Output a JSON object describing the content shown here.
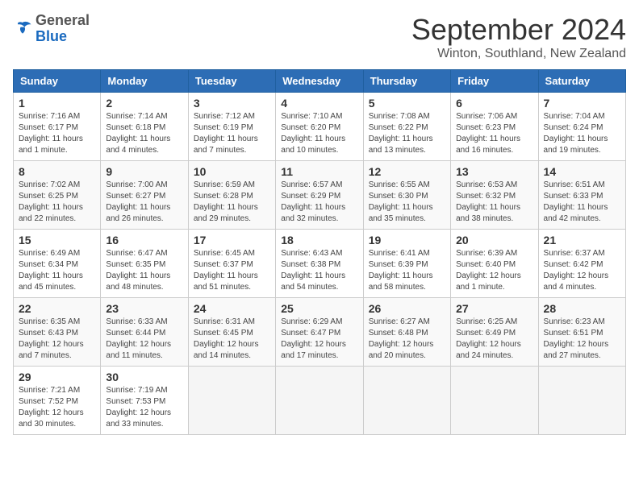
{
  "logo": {
    "general": "General",
    "blue": "Blue"
  },
  "header": {
    "month": "September 2024",
    "location": "Winton, Southland, New Zealand"
  },
  "days_of_week": [
    "Sunday",
    "Monday",
    "Tuesday",
    "Wednesday",
    "Thursday",
    "Friday",
    "Saturday"
  ],
  "weeks": [
    [
      {
        "day": "1",
        "info": "Sunrise: 7:16 AM\nSunset: 6:17 PM\nDaylight: 11 hours and 1 minute."
      },
      {
        "day": "2",
        "info": "Sunrise: 7:14 AM\nSunset: 6:18 PM\nDaylight: 11 hours and 4 minutes."
      },
      {
        "day": "3",
        "info": "Sunrise: 7:12 AM\nSunset: 6:19 PM\nDaylight: 11 hours and 7 minutes."
      },
      {
        "day": "4",
        "info": "Sunrise: 7:10 AM\nSunset: 6:20 PM\nDaylight: 11 hours and 10 minutes."
      },
      {
        "day": "5",
        "info": "Sunrise: 7:08 AM\nSunset: 6:22 PM\nDaylight: 11 hours and 13 minutes."
      },
      {
        "day": "6",
        "info": "Sunrise: 7:06 AM\nSunset: 6:23 PM\nDaylight: 11 hours and 16 minutes."
      },
      {
        "day": "7",
        "info": "Sunrise: 7:04 AM\nSunset: 6:24 PM\nDaylight: 11 hours and 19 minutes."
      }
    ],
    [
      {
        "day": "8",
        "info": "Sunrise: 7:02 AM\nSunset: 6:25 PM\nDaylight: 11 hours and 22 minutes."
      },
      {
        "day": "9",
        "info": "Sunrise: 7:00 AM\nSunset: 6:27 PM\nDaylight: 11 hours and 26 minutes."
      },
      {
        "day": "10",
        "info": "Sunrise: 6:59 AM\nSunset: 6:28 PM\nDaylight: 11 hours and 29 minutes."
      },
      {
        "day": "11",
        "info": "Sunrise: 6:57 AM\nSunset: 6:29 PM\nDaylight: 11 hours and 32 minutes."
      },
      {
        "day": "12",
        "info": "Sunrise: 6:55 AM\nSunset: 6:30 PM\nDaylight: 11 hours and 35 minutes."
      },
      {
        "day": "13",
        "info": "Sunrise: 6:53 AM\nSunset: 6:32 PM\nDaylight: 11 hours and 38 minutes."
      },
      {
        "day": "14",
        "info": "Sunrise: 6:51 AM\nSunset: 6:33 PM\nDaylight: 11 hours and 42 minutes."
      }
    ],
    [
      {
        "day": "15",
        "info": "Sunrise: 6:49 AM\nSunset: 6:34 PM\nDaylight: 11 hours and 45 minutes."
      },
      {
        "day": "16",
        "info": "Sunrise: 6:47 AM\nSunset: 6:35 PM\nDaylight: 11 hours and 48 minutes."
      },
      {
        "day": "17",
        "info": "Sunrise: 6:45 AM\nSunset: 6:37 PM\nDaylight: 11 hours and 51 minutes."
      },
      {
        "day": "18",
        "info": "Sunrise: 6:43 AM\nSunset: 6:38 PM\nDaylight: 11 hours and 54 minutes."
      },
      {
        "day": "19",
        "info": "Sunrise: 6:41 AM\nSunset: 6:39 PM\nDaylight: 11 hours and 58 minutes."
      },
      {
        "day": "20",
        "info": "Sunrise: 6:39 AM\nSunset: 6:40 PM\nDaylight: 12 hours and 1 minute."
      },
      {
        "day": "21",
        "info": "Sunrise: 6:37 AM\nSunset: 6:42 PM\nDaylight: 12 hours and 4 minutes."
      }
    ],
    [
      {
        "day": "22",
        "info": "Sunrise: 6:35 AM\nSunset: 6:43 PM\nDaylight: 12 hours and 7 minutes."
      },
      {
        "day": "23",
        "info": "Sunrise: 6:33 AM\nSunset: 6:44 PM\nDaylight: 12 hours and 11 minutes."
      },
      {
        "day": "24",
        "info": "Sunrise: 6:31 AM\nSunset: 6:45 PM\nDaylight: 12 hours and 14 minutes."
      },
      {
        "day": "25",
        "info": "Sunrise: 6:29 AM\nSunset: 6:47 PM\nDaylight: 12 hours and 17 minutes."
      },
      {
        "day": "26",
        "info": "Sunrise: 6:27 AM\nSunset: 6:48 PM\nDaylight: 12 hours and 20 minutes."
      },
      {
        "day": "27",
        "info": "Sunrise: 6:25 AM\nSunset: 6:49 PM\nDaylight: 12 hours and 24 minutes."
      },
      {
        "day": "28",
        "info": "Sunrise: 6:23 AM\nSunset: 6:51 PM\nDaylight: 12 hours and 27 minutes."
      }
    ],
    [
      {
        "day": "29",
        "info": "Sunrise: 7:21 AM\nSunset: 7:52 PM\nDaylight: 12 hours and 30 minutes."
      },
      {
        "day": "30",
        "info": "Sunrise: 7:19 AM\nSunset: 7:53 PM\nDaylight: 12 hours and 33 minutes."
      },
      {
        "day": "",
        "info": ""
      },
      {
        "day": "",
        "info": ""
      },
      {
        "day": "",
        "info": ""
      },
      {
        "day": "",
        "info": ""
      },
      {
        "day": "",
        "info": ""
      }
    ]
  ]
}
